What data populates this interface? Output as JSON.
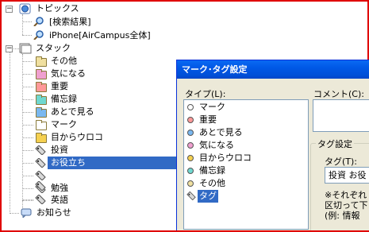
{
  "tree": {
    "topics": {
      "label": "トピックス"
    },
    "search_results": {
      "label": "[検索結果]"
    },
    "iphone": {
      "label": "iPhone[AirCampus全体]"
    },
    "stack": {
      "label": "スタック"
    },
    "items": [
      {
        "label": "その他",
        "color": "#f0e0a0"
      },
      {
        "label": "気になる",
        "color": "#f0a0d0"
      },
      {
        "label": "重要",
        "color": "#ff9999"
      },
      {
        "label": "備忘録",
        "color": "#70d8d0"
      },
      {
        "label": "あとで見る",
        "color": "#7ab8f0"
      },
      {
        "label": "マーク",
        "color": "#ffffff"
      },
      {
        "label": "目からウロコ",
        "color": "#f5d050"
      }
    ],
    "tags": [
      {
        "label": "投資"
      },
      {
        "label": "お役立ち"
      },
      {
        "label": ""
      },
      {
        "label": ""
      },
      {
        "label": "勉強"
      },
      {
        "label": "英語"
      }
    ],
    "notices": {
      "label": "お知らせ"
    }
  },
  "dialog": {
    "title": "マーク･タグ設定",
    "type_label": "タイプ(L):",
    "comment_label": "コメント(C):",
    "tag_group_label": "タグ設定",
    "tag_field_label": "タグ(T):",
    "tag_value": "投資 お役",
    "note_line1": "※それぞれ",
    "note_line2": "区切って下",
    "note_line3": "(例: 情報",
    "types": [
      {
        "label": "マーク",
        "color": "#ffffff"
      },
      {
        "label": "重要",
        "color": "#ff9999"
      },
      {
        "label": "あとで見る",
        "color": "#7ab8f0"
      },
      {
        "label": "気になる",
        "color": "#f0a0d0"
      },
      {
        "label": "目からウロコ",
        "color": "#f5d050"
      },
      {
        "label": "備忘録",
        "color": "#70d8d0"
      },
      {
        "label": "その他",
        "color": "#f0e0a0"
      },
      {
        "label": "タグ",
        "color": ""
      }
    ]
  }
}
